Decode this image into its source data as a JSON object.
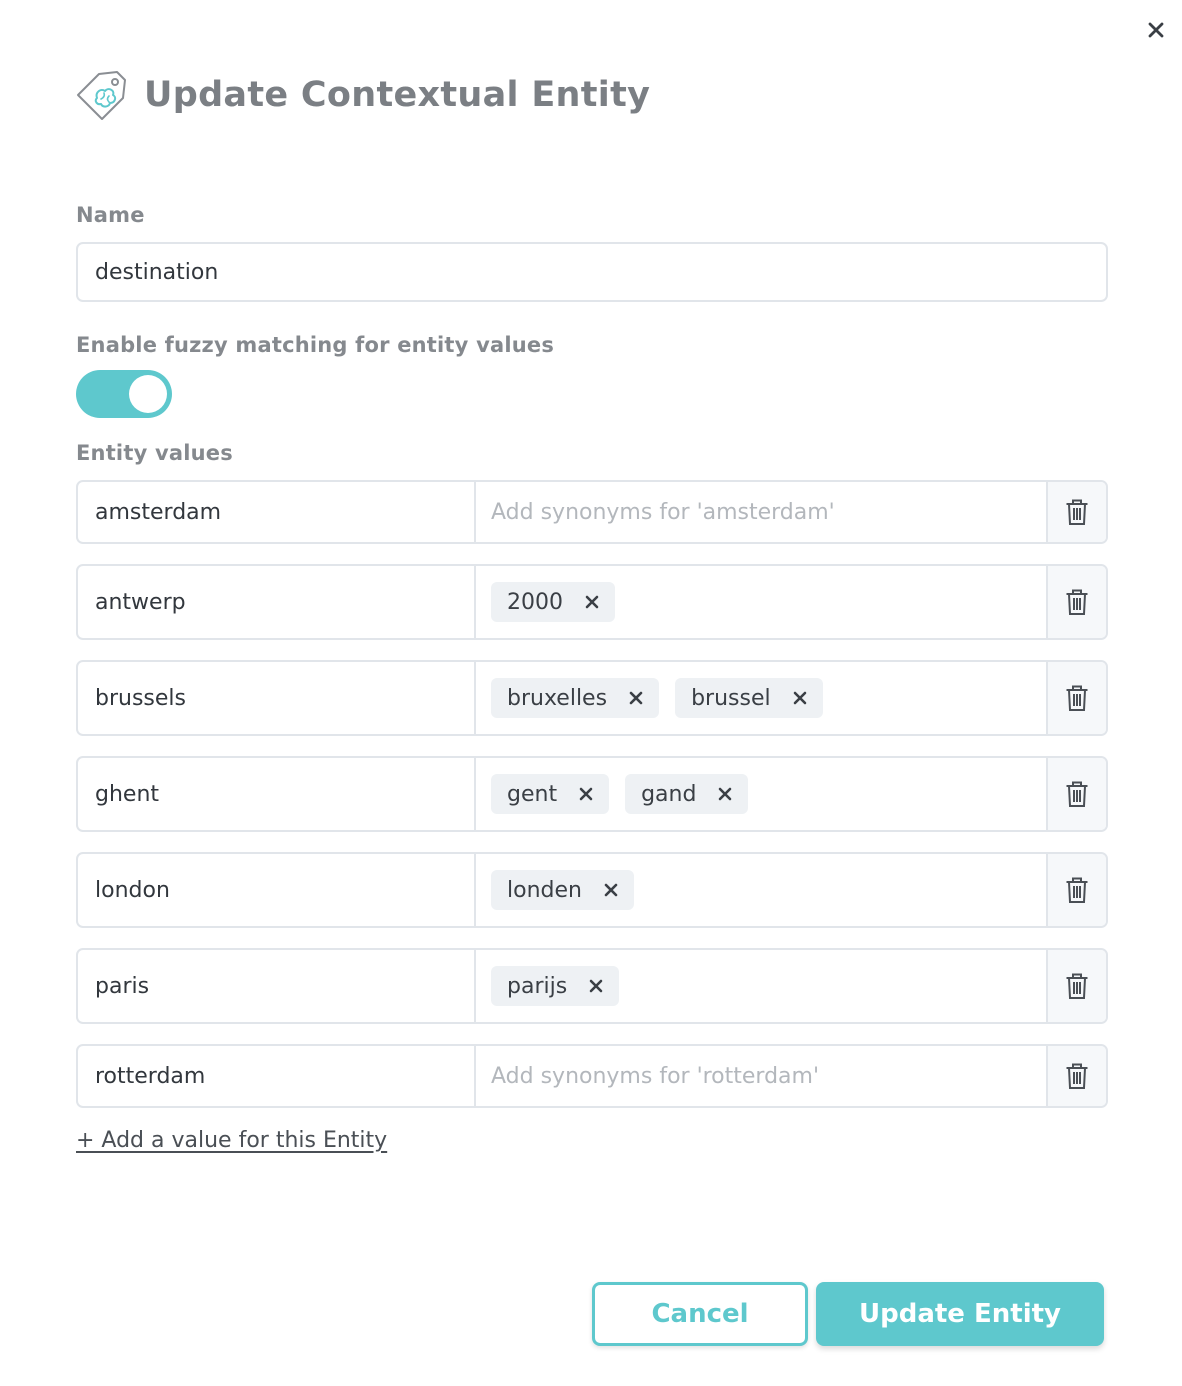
{
  "dialog": {
    "title": "Update Contextual Entity",
    "close_icon": "close-icon",
    "title_icon": "entity-tag-icon"
  },
  "form": {
    "name_label": "Name",
    "name_value": "destination",
    "fuzzy_label": "Enable fuzzy matching for entity values",
    "fuzzy_enabled": true,
    "values_label": "Entity values"
  },
  "entity_values": [
    {
      "value": "amsterdam",
      "synonyms": [],
      "placeholder": "Add synonyms for 'amsterdam'"
    },
    {
      "value": "antwerp",
      "synonyms": [
        "2000"
      ]
    },
    {
      "value": "brussels",
      "synonyms": [
        "bruxelles",
        "brussel"
      ]
    },
    {
      "value": "ghent",
      "synonyms": [
        "gent",
        "gand"
      ]
    },
    {
      "value": "london",
      "synonyms": [
        "londen"
      ]
    },
    {
      "value": "paris",
      "synonyms": [
        "parijs"
      ]
    },
    {
      "value": "rotterdam",
      "synonyms": [],
      "placeholder": "Add synonyms for 'rotterdam'"
    }
  ],
  "add_value_link": "+ Add a value for this Entity",
  "buttons": {
    "cancel": "Cancel",
    "update": "Update Entity"
  },
  "colors": {
    "accent": "#5ec8cd",
    "title": "#7b7f84",
    "chip_bg": "#eef1f4"
  }
}
